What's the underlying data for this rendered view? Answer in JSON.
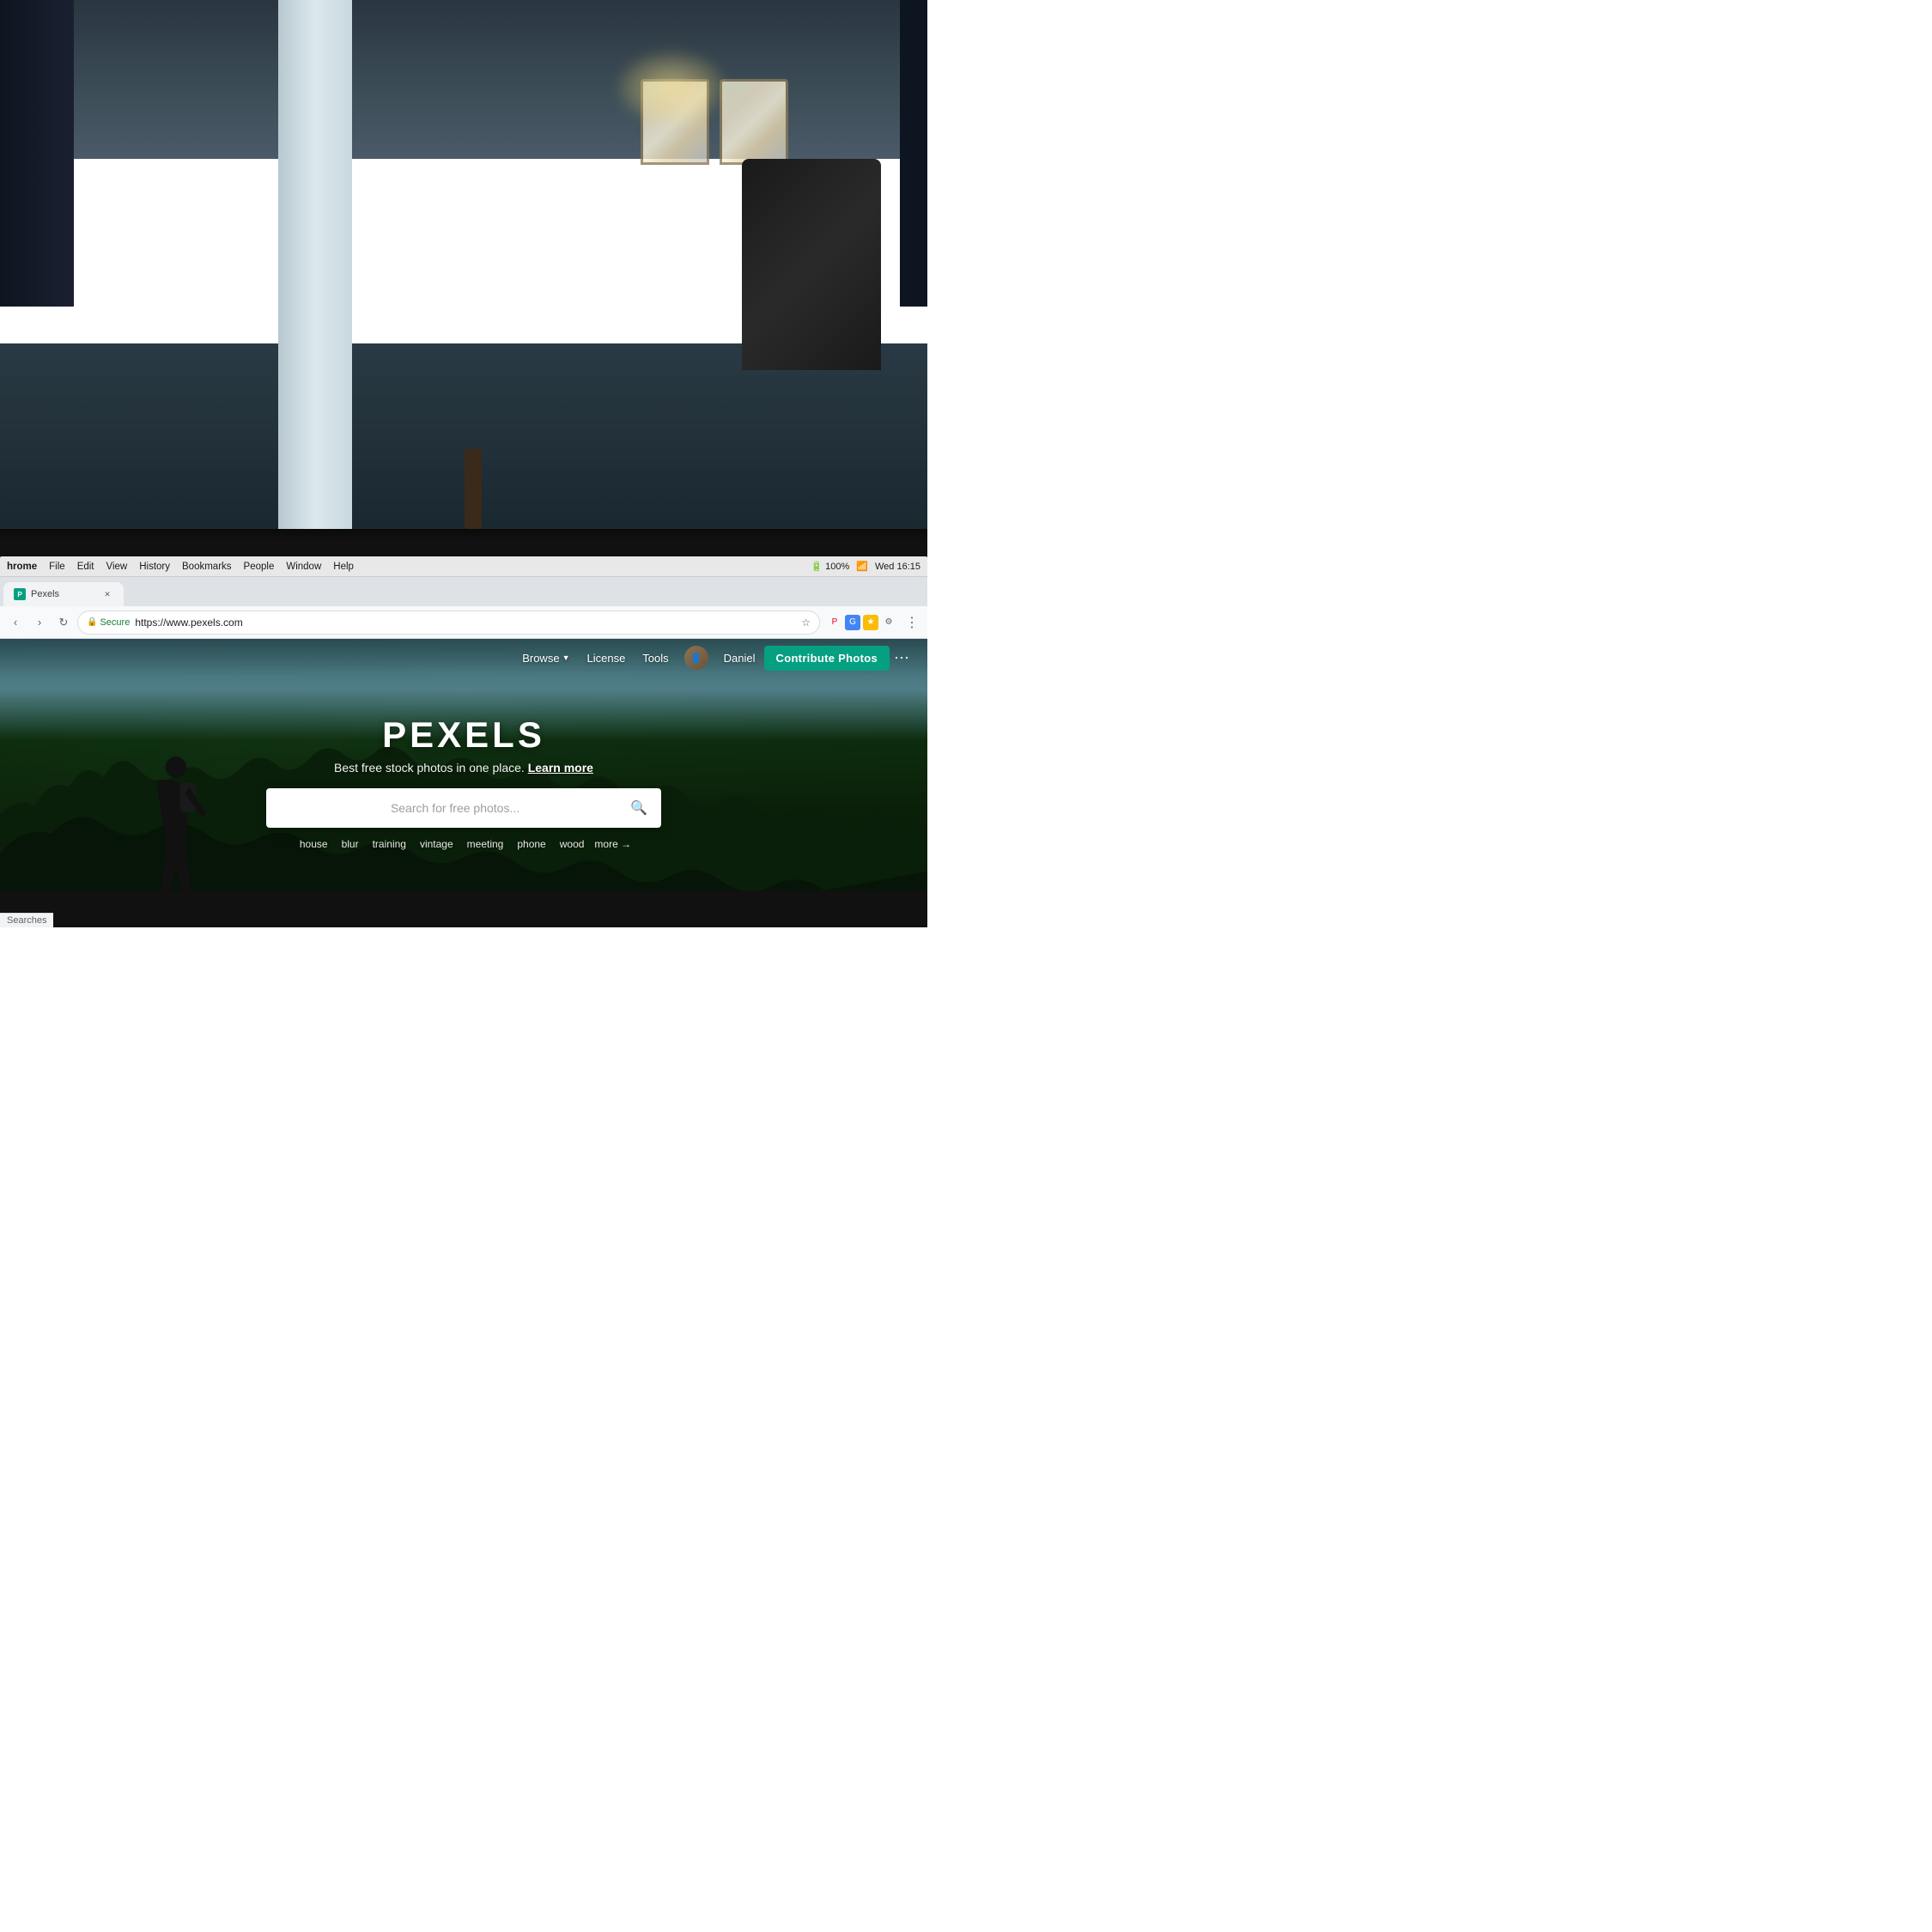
{
  "background": {
    "type": "office_room",
    "description": "Blurred office/workspace background with windows, plants, pillar"
  },
  "os_menubar": {
    "app_name": "hrome",
    "menu_items": [
      "File",
      "Edit",
      "View",
      "History",
      "Bookmarks",
      "People",
      "Window",
      "Help"
    ],
    "right_items": "Wed 16:15",
    "battery": "100 %"
  },
  "browser": {
    "tab_title": "Pexels",
    "tab_favicon": "P",
    "address": {
      "secure_label": "Secure",
      "url": "https://www.pexels.com"
    },
    "toolbar_buttons": {
      "back": "←",
      "forward": "→",
      "refresh": "↺"
    }
  },
  "pexels": {
    "navbar": {
      "browse_label": "Browse",
      "license_label": "License",
      "tools_label": "Tools",
      "user_name": "Daniel",
      "contribute_label": "Contribute Photos"
    },
    "hero": {
      "logo": "PEXELS",
      "tagline": "Best free stock photos in one place.",
      "learn_more": "Learn more",
      "search_placeholder": "Search for free photos...",
      "suggestions": [
        "house",
        "blur",
        "training",
        "vintage",
        "meeting",
        "phone",
        "wood"
      ],
      "more_label": "more →"
    }
  },
  "statusbar": {
    "text": "Searches"
  }
}
